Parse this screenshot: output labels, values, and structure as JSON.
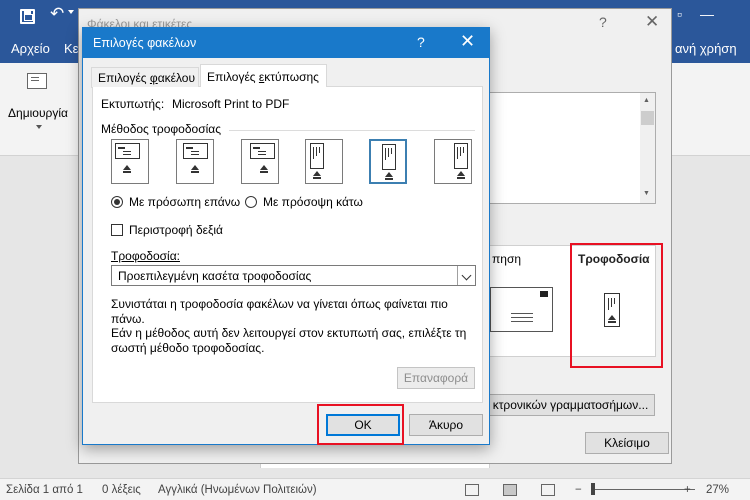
{
  "word": {
    "tabs": [
      "Αρχείο",
      "Κε",
      "ανή χρήση"
    ],
    "ribbon": {
      "create_label": "Δημιουργία"
    }
  },
  "envelopes_dialog": {
    "title": "Φάκελοι και ετικέτες",
    "help": "?",
    "close": "✕",
    "preview_label": "πηση",
    "feed_label": "Τροφοδοσία",
    "postage_button": "κτρονικών γραμματοσήμων...",
    "close_button": "Κλείσιμο"
  },
  "options_dialog": {
    "title": "Επιλογές φακέλων",
    "help": "?",
    "close": "✕",
    "tabs": [
      {
        "prefix": "Επιλογές ",
        "underline": "φ",
        "suffix": "ακέλου",
        "active": false
      },
      {
        "prefix": "Επιλογές ",
        "underline": "ε",
        "suffix": "κτύπωσης",
        "active": true
      }
    ],
    "printer_label": "Εκτυπωτής:",
    "printer_name": "Microsoft Print to PDF",
    "feed_method_label": "Μέθοδος τροφοδοσίας",
    "feed_methods": [
      {
        "name": "horizontal-left",
        "selected": false
      },
      {
        "name": "horizontal-center",
        "selected": false
      },
      {
        "name": "horizontal-right",
        "selected": false
      },
      {
        "name": "vertical-left",
        "selected": false
      },
      {
        "name": "vertical-center",
        "selected": true
      },
      {
        "name": "vertical-right",
        "selected": false
      }
    ],
    "face_up_label": "Με πρόσωπη επάνω",
    "face_down_label": "Με πρόσοψη κάτω",
    "face_up_selected": true,
    "rotate_label": "Περιστροφή δεξιά",
    "rotate_checked": false,
    "feed_from_label": "Τροφοδοσία:",
    "feed_from_value": "Προεπιλεγμένη κασέτα τροφοδοσίας",
    "description": [
      "Συνιστάται η τροφοδοσία φακέλων να γίνεται όπως φαίνεται πιο πάνω.",
      "Εάν η μέθοδος αυτή δεν λειτουργεί στον εκτυπωτή σας, επιλέξτε τη σωστή μέθοδο τροφοδοσίας."
    ],
    "reset_button": "Επαναφορά",
    "ok_button": "OK",
    "cancel_button": "Άκυρο"
  },
  "status_bar": {
    "page": "Σελίδα 1 από 1",
    "words": "0 λέξεις",
    "language": "Αγγλικά (Ηνωμένων Πολιτειών)",
    "zoom": "27%"
  },
  "colors": {
    "word_blue": "#2b579a",
    "dialog_blue": "#1979ca",
    "highlight_red": "#e81123"
  }
}
